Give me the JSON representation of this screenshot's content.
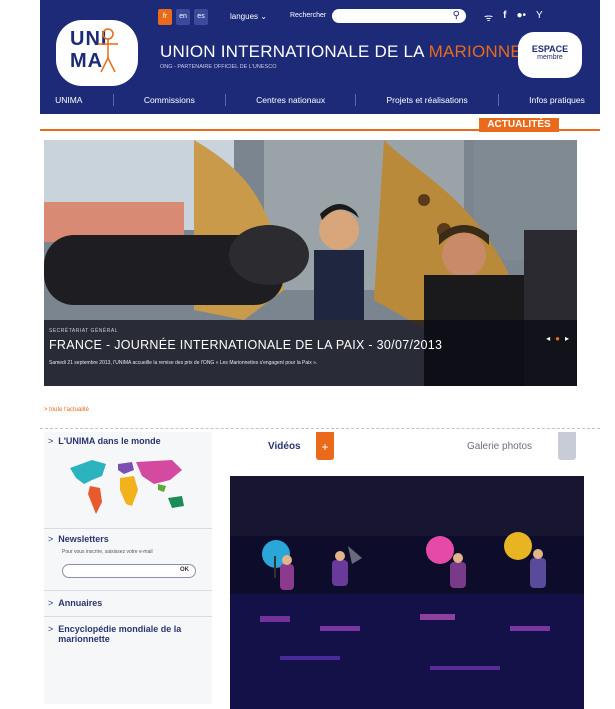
{
  "header": {
    "languages": [
      "fr",
      "en",
      "es"
    ],
    "active_language": "fr",
    "langues_label": "langues",
    "search_label": "Rechercher",
    "search_icon": "search-icon",
    "social_icons": [
      "rss-icon",
      "facebook-icon",
      "flickr-icon",
      "youtube-icon"
    ],
    "logo_line1": "UNI",
    "logo_line2": "MA",
    "title_main": "UNION INTERNATIONALE DE LA ",
    "title_accent": "MARIONNETTE",
    "subtitle": "ONG - PARTENAIRE OFFICIEL DE L'UNESCO",
    "espace_line1": "ESPACE",
    "espace_line2": "membre",
    "accent_color": "#e86a1a",
    "brand_color": "#1d2a78"
  },
  "nav": {
    "items": [
      "UNIMA",
      "Commissions",
      "Centres nationaux",
      "Projets et réalisations",
      "Infos pratiques"
    ]
  },
  "actualites": {
    "tab_label": "ACTUALITÉS",
    "kicker": "SECRÉTARIAT GÉNÉRAL",
    "title": "FRANCE - JOURNÉE INTERNATIONALE DE LA PAIX - 30/07/2013",
    "text": "Samedi 21 septembre 2013, l'UNIMA accueille la remise des prix de l'ONG « Les Marionnettes s'engagent pour la Paix ».",
    "more_link": "> toute l'actualité"
  },
  "sidebar": {
    "world_title": "L'UNIMA dans le monde",
    "newsletter_title": "Newsletters",
    "newsletter_text": "Pour vous inscrire, saisissez votre e-mail",
    "newsletter_button": "OK",
    "annuaires": "Annuaires",
    "encyclopedie": "Encyclopédie mondiale de la marionnette"
  },
  "media": {
    "videos_label": "Vidéos",
    "plus_label": "+",
    "galerie_label": "Galerie photos"
  }
}
